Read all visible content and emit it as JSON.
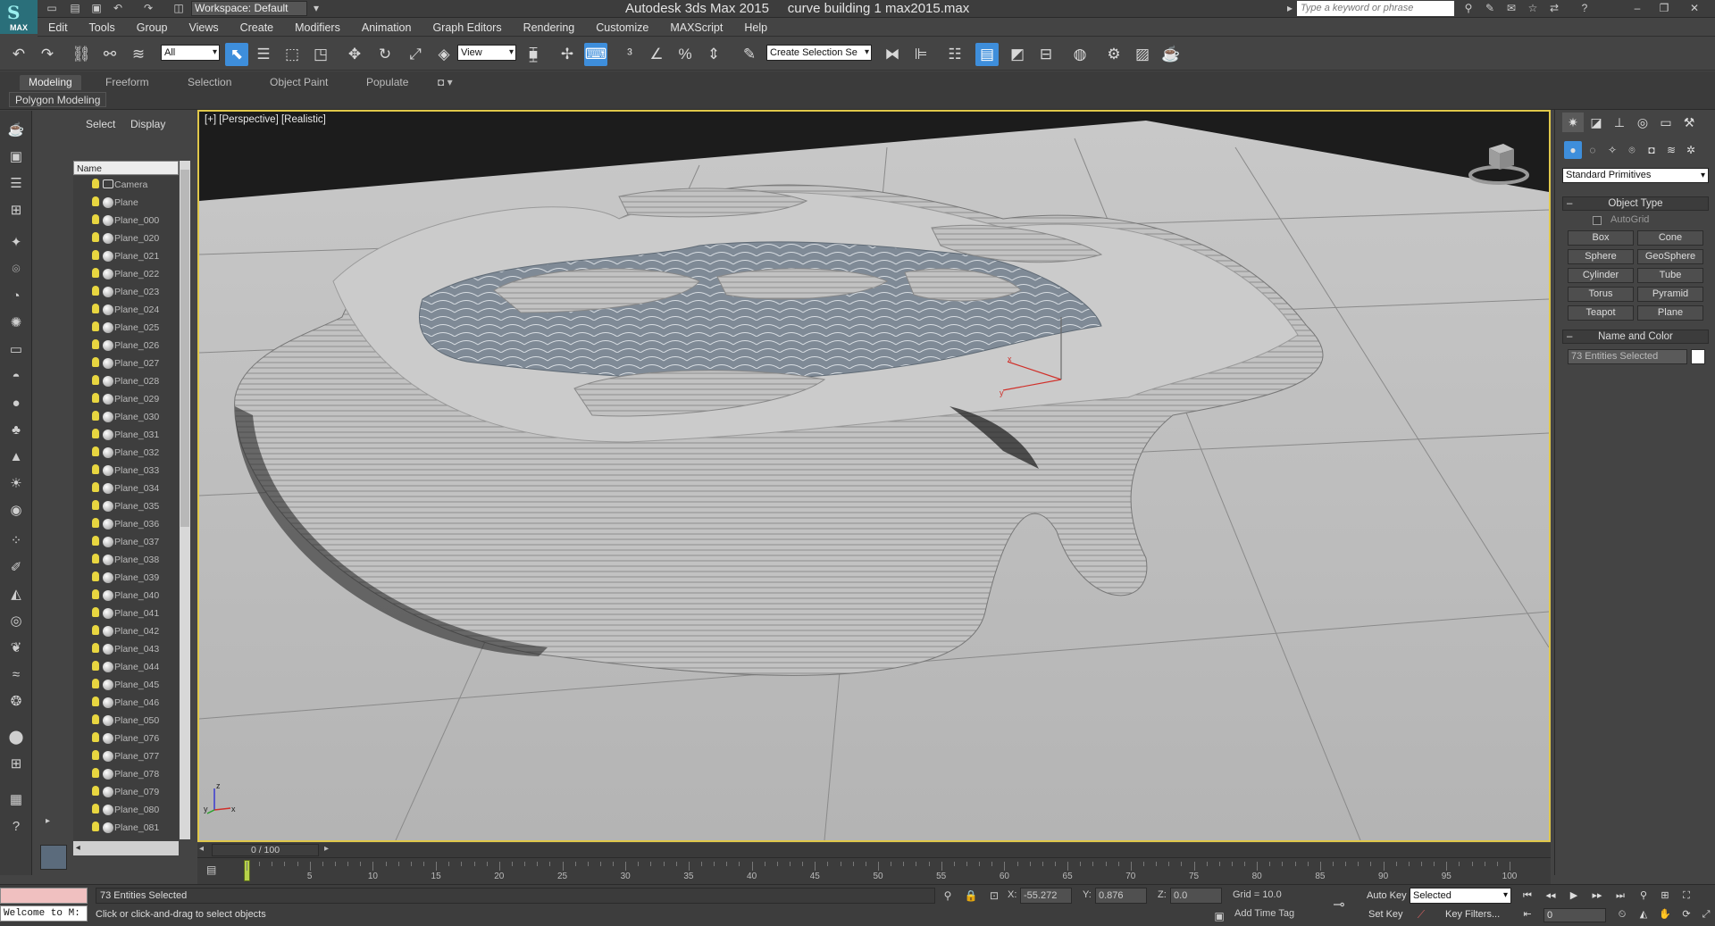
{
  "titlebar": {
    "logo": "MAX",
    "workspace": "Workspace: Default",
    "app_title": "Autodesk 3ds Max  2015",
    "file_title": "curve building 1 max2015.max",
    "search_placeholder": "Type a keyword or phrase"
  },
  "menu": [
    "Edit",
    "Tools",
    "Group",
    "Views",
    "Create",
    "Modifiers",
    "Animation",
    "Graph Editors",
    "Rendering",
    "Customize",
    "MAXScript",
    "Help"
  ],
  "toolbar": {
    "selection_filter": "All",
    "ref_coord": "View",
    "named_selection": "Create Selection Se"
  },
  "ribbon": {
    "tabs": [
      "Modeling",
      "Freeform",
      "Selection",
      "Object Paint",
      "Populate"
    ],
    "panel": "Polygon Modeling"
  },
  "scene_explorer": {
    "tabs": [
      "Select",
      "Display"
    ],
    "column": "Name",
    "items": [
      "Camera",
      "Plane",
      "Plane_000",
      "Plane_020",
      "Plane_021",
      "Plane_022",
      "Plane_023",
      "Plane_024",
      "Plane_025",
      "Plane_026",
      "Plane_027",
      "Plane_028",
      "Plane_029",
      "Plane_030",
      "Plane_031",
      "Plane_032",
      "Plane_033",
      "Plane_034",
      "Plane_035",
      "Plane_036",
      "Plane_037",
      "Plane_038",
      "Plane_039",
      "Plane_040",
      "Plane_041",
      "Plane_042",
      "Plane_043",
      "Plane_044",
      "Plane_045",
      "Plane_046",
      "Plane_050",
      "Plane_076",
      "Plane_077",
      "Plane_078",
      "Plane_079",
      "Plane_080",
      "Plane_081"
    ]
  },
  "viewport": {
    "label": "[+] [Perspective] [Realistic]",
    "axis_x": "x",
    "axis_y": "y",
    "axis_z": "z"
  },
  "command_panel": {
    "category": "Standard Primitives",
    "object_type_title": "Object Type",
    "autogrid": "AutoGrid",
    "buttons": [
      "Box",
      "Cone",
      "Sphere",
      "GeoSphere",
      "Cylinder",
      "Tube",
      "Torus",
      "Pyramid",
      "Teapot",
      "Plane"
    ],
    "name_color_title": "Name and Color",
    "name_value": "73 Entities Selected"
  },
  "timeline": {
    "slider": "0 / 100",
    "current_frame": 0,
    "ticks": [
      "0",
      "5",
      "10",
      "15",
      "20",
      "25",
      "30",
      "35",
      "40",
      "45",
      "50",
      "55",
      "60",
      "65",
      "70",
      "75",
      "80",
      "85",
      "90",
      "95",
      "100"
    ]
  },
  "status": {
    "welcome": "Welcome to M:",
    "selected": "73 Entities Selected",
    "prompt": "Click or click-and-drag to select objects",
    "x_label": "X:",
    "x": "-55.272",
    "y_label": "Y:",
    "y": "0.876",
    "z_label": "Z:",
    "z": "0.0",
    "grid": "Grid = 10.0",
    "add_time_tag": "Add Time Tag",
    "auto_key": "Auto Key",
    "set_key": "Set Key",
    "selected_dd": "Selected",
    "key_filters": "Key Filters...",
    "frame": "0"
  },
  "colors": {
    "viewport_border": "#e0c84a",
    "active_blue": "#3e8edb",
    "time_marker": "#b7d24a"
  }
}
